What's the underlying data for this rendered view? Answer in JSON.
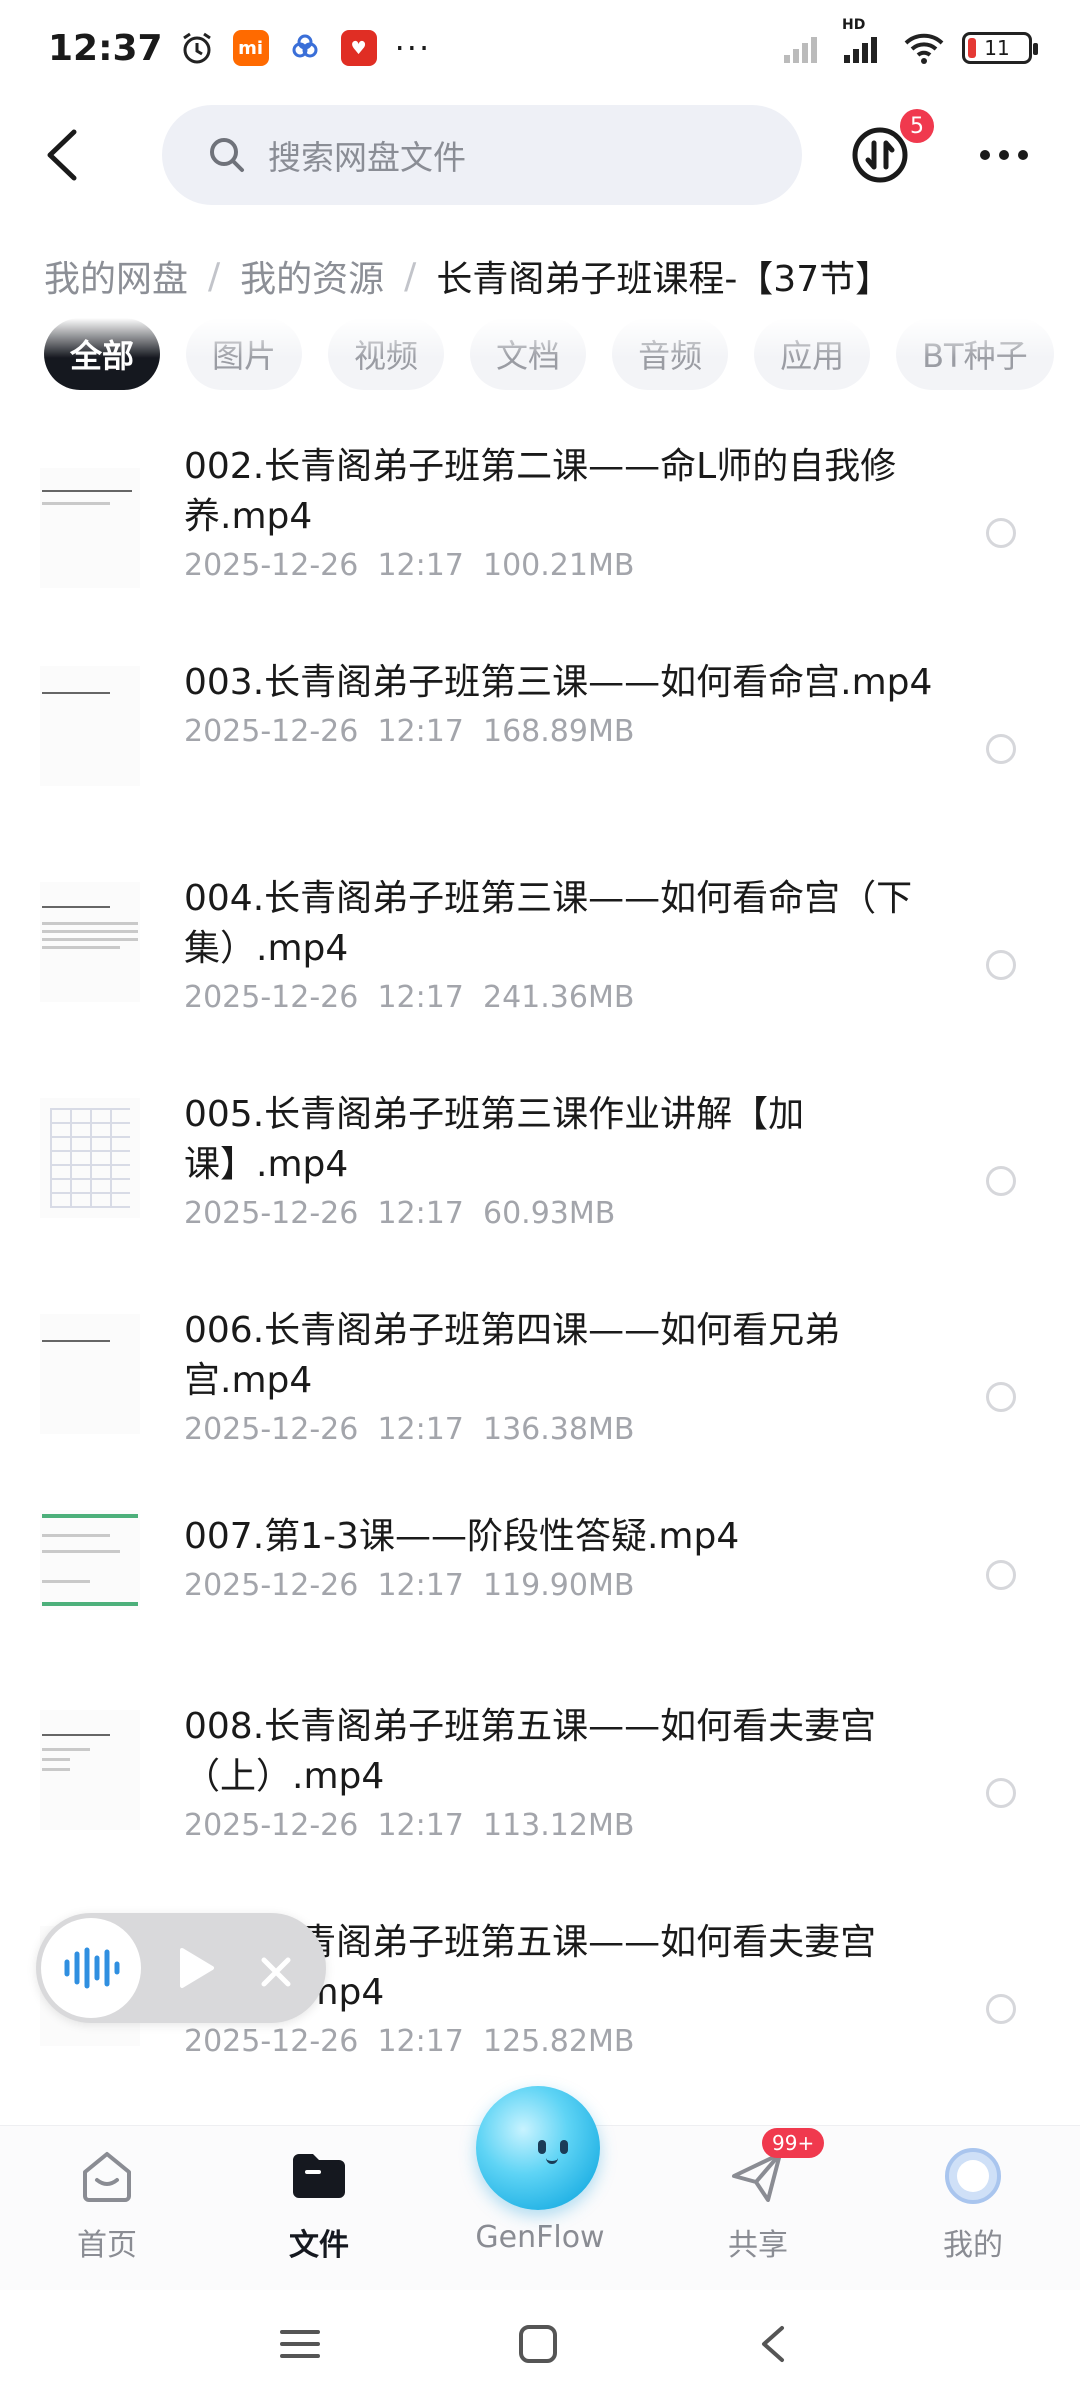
{
  "status_bar": {
    "time": "12:37",
    "notification_icons": [
      "alarm-icon",
      "mi-app-icon",
      "cloud-app-icon",
      "pinduoduo-app-icon",
      "more-notifications-icon"
    ],
    "network": "HD",
    "battery": "11",
    "colors": {
      "mi_app": "#ff6a00",
      "pdd_app": "#e02e24",
      "battery_low": "#e53935"
    }
  },
  "header": {
    "back_icon": "back-arrow-icon",
    "search_placeholder": "搜索网盘文件",
    "transfer_icon": "transfer-icon",
    "transfer_badge": "5",
    "more_icon": "more-dots-icon"
  },
  "breadcrumb": {
    "items": [
      "我的网盘",
      "我的资源"
    ],
    "separator": "/",
    "current": "长青阁弟子班课程-【37节】"
  },
  "filters": [
    "全部",
    "图片",
    "视频",
    "文档",
    "音频",
    "应用",
    "BT种子"
  ],
  "files": [
    {
      "title": "002.长青阁弟子班第二课——命L师的自我修养.mp4",
      "date": "2025-12-26",
      "time": "12:17",
      "size": "100.21MB"
    },
    {
      "title": "003.长青阁弟子班第三课——如何看命宫.mp4",
      "date": "2025-12-26",
      "time": "12:17",
      "size": "168.89MB"
    },
    {
      "title": "004.长青阁弟子班第三课——如何看命宫（下集）.mp4",
      "date": "2025-12-26",
      "time": "12:17",
      "size": "241.36MB"
    },
    {
      "title": "005.长青阁弟子班第三课作业讲解【加课】.mp4",
      "date": "2025-12-26",
      "time": "12:17",
      "size": "60.93MB"
    },
    {
      "title": "006.长青阁弟子班第四课——如何看兄弟宫.mp4",
      "date": "2025-12-26",
      "time": "12:17",
      "size": "136.38MB"
    },
    {
      "title": "007.第1-3课——阶段性答疑.mp4",
      "date": "2025-12-26",
      "time": "12:17",
      "size": "119.90MB"
    },
    {
      "title": "008.长青阁弟子班第五课——如何看夫妻宫（上）.mp4",
      "date": "2025-12-26",
      "time": "12:17",
      "size": "113.12MB"
    },
    {
      "title": "009.长青阁弟子班第五课——如何看夫妻宫（下）.mp4",
      "date": "2025-12-26",
      "time": "12:17",
      "size": "125.82MB"
    }
  ],
  "player": {
    "wave_icon": "audio-wave-icon",
    "play_icon": "play-icon",
    "close_icon": "close-icon"
  },
  "bottom_nav": {
    "items": [
      {
        "label": "首页",
        "icon": "home-icon"
      },
      {
        "label": "文件",
        "icon": "folder-icon",
        "active": true
      },
      {
        "label": "GenFlow",
        "icon": "genflow-orb-icon"
      },
      {
        "label": "共享",
        "icon": "share-icon",
        "badge": "99+"
      },
      {
        "label": "我的",
        "icon": "profile-icon"
      }
    ],
    "accent": "#15181f"
  },
  "system_nav": [
    "menu-icon",
    "home-square-icon",
    "back-chevron-icon"
  ]
}
